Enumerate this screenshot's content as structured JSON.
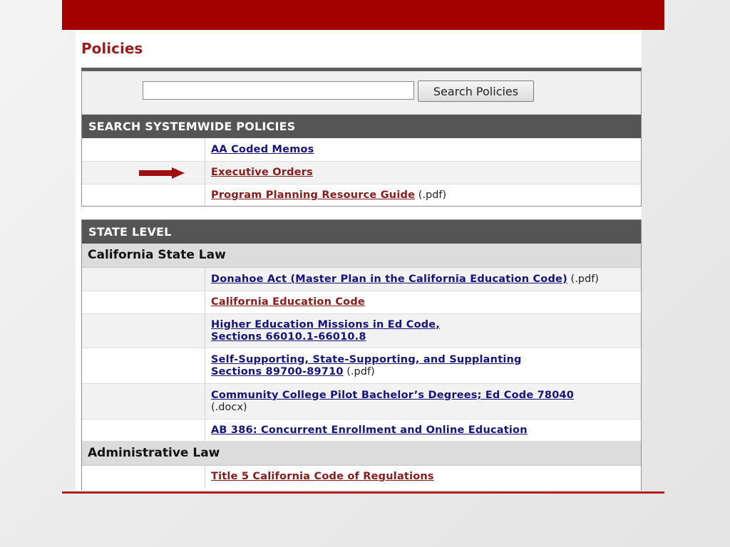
{
  "page": {
    "title": "Policies"
  },
  "search": {
    "placeholder": "",
    "value": "",
    "button_label": "Search Policies"
  },
  "systemwide": {
    "header": "SEARCH SYSTEMWIDE POLICIES",
    "items": [
      {
        "label": "AA Coded Memos",
        "suffix": ""
      },
      {
        "label": "Executive Orders",
        "suffix": ""
      },
      {
        "label": "Program Planning Resource Guide",
        "suffix": " (.pdf)"
      }
    ]
  },
  "state_level": {
    "header": "STATE LEVEL",
    "sections": [
      {
        "title": "California State Law",
        "items": [
          {
            "label": "Donahoe Act (Master Plan in the California Education Code)",
            "suffix": " (.pdf)"
          },
          {
            "label": "California Education Code",
            "suffix": ""
          },
          {
            "label_line1": "Higher Education Missions in Ed Code,",
            "label_line2": "Sections 66010.1-66010.8",
            "suffix": ""
          },
          {
            "label_line1": "Self-Supporting, State-Supporting, and Supplanting",
            "label_line2": "Sections 89700-89710",
            "suffix": " (.pdf)"
          },
          {
            "label": "Community College Pilot Bachelor’s Degrees; Ed Code 78040",
            "suffix_line2": "(.docx)"
          },
          {
            "label": "AB 386: Concurrent Enrollment and Online Education",
            "suffix": ""
          }
        ]
      },
      {
        "title": "Administrative Law",
        "items": [
          {
            "label": "Title 5 California Code of Regulations",
            "suffix": ""
          }
        ]
      }
    ]
  },
  "colors": {
    "brand_red": "#a50000",
    "arrow": "#a00d0d",
    "link": "#14147a",
    "visited_link": "#8b1a1a",
    "header_bg": "#555555"
  }
}
